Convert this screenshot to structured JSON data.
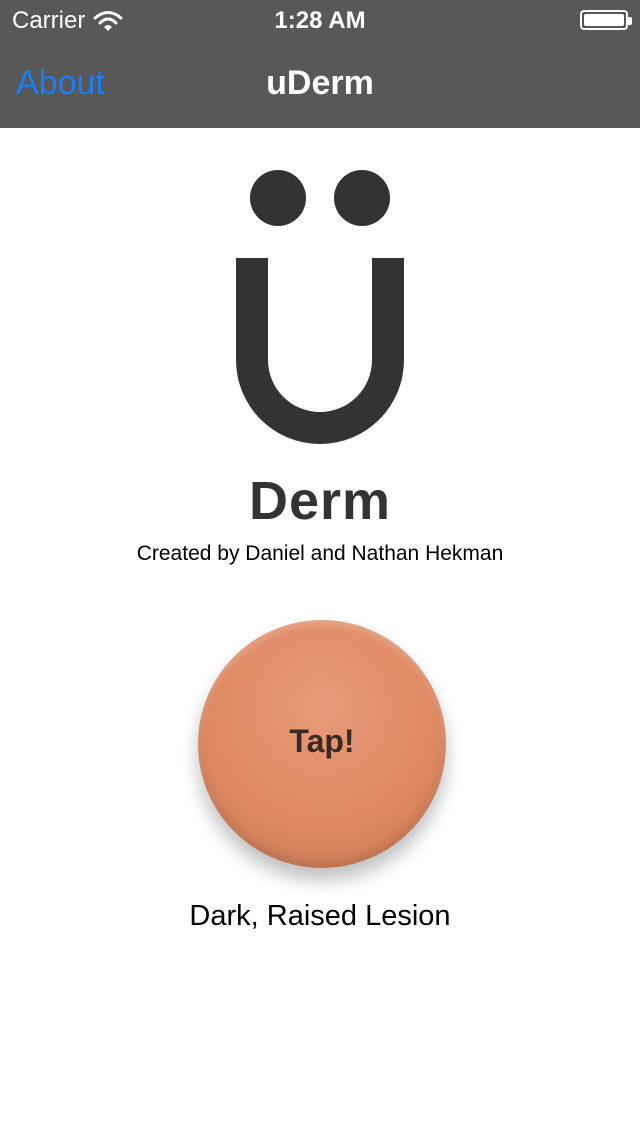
{
  "status_bar": {
    "carrier": "Carrier",
    "time": "1:28 AM",
    "wifi_icon": "wifi-icon",
    "battery_icon": "battery-icon"
  },
  "nav": {
    "back_label": "About",
    "title": "uDerm"
  },
  "logo": {
    "icon": "u-umlaut-logo",
    "color": "#333333"
  },
  "brand": {
    "name": "Derm",
    "credits": "Created by Daniel and Nathan Hekman"
  },
  "tap_button": {
    "label": "Tap!",
    "color": "#df8a64"
  },
  "result": {
    "label": "Dark, Raised Lesion"
  },
  "colors": {
    "header_bg": "#585858",
    "link": "#1a7ef5"
  }
}
